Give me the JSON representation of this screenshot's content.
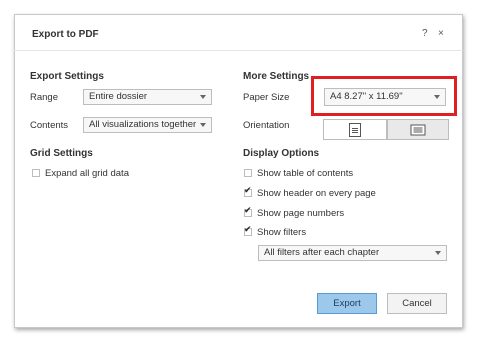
{
  "dialog": {
    "title": "Export to PDF",
    "help_icon": "?",
    "close_icon": "×"
  },
  "export_settings": {
    "heading": "Export Settings",
    "range_label": "Range",
    "range_value": "Entire dossier",
    "contents_label": "Contents",
    "contents_value": "All visualizations together"
  },
  "grid_settings": {
    "heading": "Grid Settings",
    "expand_label": "Expand all grid data",
    "expand_checked": false
  },
  "more_settings": {
    "heading": "More Settings",
    "paper_size_label": "Paper Size",
    "paper_size_value": "A4 8.27\" x 11.69\"",
    "orientation_label": "Orientation",
    "orientation_options": [
      "portrait",
      "landscape"
    ],
    "orientation_selected": "landscape"
  },
  "display_options": {
    "heading": "Display Options",
    "options": [
      {
        "label": "Show table of contents",
        "checked": false
      },
      {
        "label": "Show header on every page",
        "checked": true
      },
      {
        "label": "Show page numbers",
        "checked": true
      },
      {
        "label": "Show filters",
        "checked": true
      }
    ],
    "filters_value": "All filters after each chapter"
  },
  "buttons": {
    "export": "Export",
    "cancel": "Cancel"
  },
  "colors": {
    "highlight_border": "#e02020",
    "primary_button": "#9cc8ec"
  }
}
